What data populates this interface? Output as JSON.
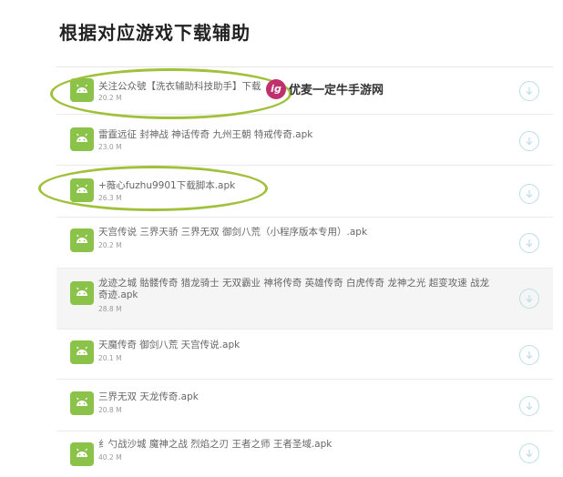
{
  "page": {
    "title": "根据对应游戏下载辅助"
  },
  "files": [
    {
      "name": "关注公众號【洗衣辅助科技助手】下载",
      "size": "20.2 M",
      "icon": "android-icon",
      "action_icon": "download-icon"
    },
    {
      "name": "雷霆远征 封神战 神话传奇 九州王朝 特戒传奇.apk",
      "size": "23.0 M",
      "icon": "android-icon",
      "action_icon": "download-icon"
    },
    {
      "name": "+薇心fuzhu9901下载脚本.apk",
      "size": "26.3 M",
      "icon": "android-icon",
      "action_icon": "download-icon"
    },
    {
      "name": "天宫传说 三界天骄 三界无双 御剑八荒（小程序版本专用）.apk",
      "size": "20.2 M",
      "icon": "android-icon",
      "action_icon": "download-icon"
    },
    {
      "name": "龙迹之城 骷髅传奇 猎龙骑士 无双霸业 神将传奇 英雄传奇 白虎传奇 龙神之光 超变攻速 战龙奇迹.apk",
      "size": "28.8 M",
      "icon": "android-icon",
      "action_icon": "download-icon"
    },
    {
      "name": "天魔传奇 御剑八荒 天宫传说.apk",
      "size": "20.1 M",
      "icon": "android-icon",
      "action_icon": "download-icon"
    },
    {
      "name": "三界无双 天龙传奇.apk",
      "size": "20.8 M",
      "icon": "android-icon",
      "action_icon": "download-icon"
    },
    {
      "name": "纟勺战沙城 魔神之战 烈焰之刃 王者之师 王者圣域.apk",
      "size": "40.2 M",
      "icon": "android-icon",
      "action_icon": "download-icon"
    }
  ],
  "watermark": {
    "logo_text": "ig",
    "text": "优麦一定牛手游网"
  },
  "colors": {
    "icon_bg": "#8bc34a",
    "circle_mark": "#a1c03c",
    "download_ring": "#bcdde8",
    "watermark_logo": "#c0306e"
  }
}
